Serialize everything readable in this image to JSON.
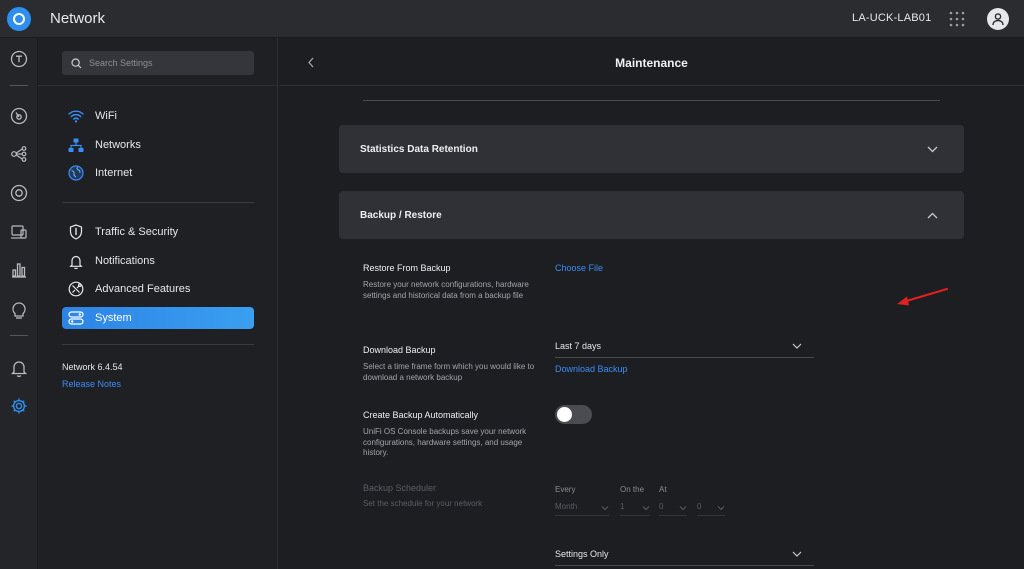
{
  "app": {
    "title": "Network",
    "device_name": "LA-UCK-LAB01"
  },
  "rail": {
    "icons": [
      "topology-t-icon",
      "dashboard-icon",
      "topology-icon",
      "target-icon",
      "devices-icon",
      "statistics-icon",
      "insights-icon",
      "alerts-icon",
      "settings-icon"
    ]
  },
  "sidebar": {
    "search_placeholder": "Search Settings",
    "groups": [
      [
        {
          "label": "WiFi",
          "icon": "wifi-icon"
        },
        {
          "label": "Networks",
          "icon": "networks-icon"
        },
        {
          "label": "Internet",
          "icon": "globe-icon"
        }
      ],
      [
        {
          "label": "Traffic & Security",
          "icon": "shield-icon"
        },
        {
          "label": "Notifications",
          "icon": "bell-icon"
        },
        {
          "label": "Advanced Features",
          "icon": "tools-icon"
        },
        {
          "label": "System",
          "icon": "system-icon",
          "active": true
        }
      ]
    ],
    "version": "Network 6.4.54",
    "release_notes": "Release Notes"
  },
  "main": {
    "title": "Maintenance",
    "panels": [
      {
        "title": "Statistics Data Retention",
        "expanded": false
      },
      {
        "title": "Backup / Restore",
        "expanded": true
      }
    ],
    "restore": {
      "label": "Restore From Backup",
      "desc": "Restore your network configurations, hardware settings and historical data from a backup file",
      "action": "Choose File"
    },
    "download": {
      "label": "Download Backup",
      "desc": "Select a time frame form which you would like to download a network backup",
      "select_value": "Last 7 days",
      "action": "Download Backup"
    },
    "auto_backup": {
      "label": "Create Backup Automatically",
      "desc": "UniFi OS Console backups save your network configurations, hardware settings, and usage history.",
      "enabled": false
    },
    "scheduler": {
      "label": "Backup Scheduler",
      "desc": "Set the schedule for your network",
      "every_label": "Every",
      "every_value": "Month",
      "on_the_label": "On the",
      "on_the_value": "1",
      "at_label": "At",
      "hour_value": "0",
      "minute_value": "0"
    },
    "settings_select_value": "Settings Only"
  },
  "colors": {
    "accent": "#3a8ef5",
    "active_nav": "#2d84e6",
    "annotation_arrow": "#e02020"
  }
}
